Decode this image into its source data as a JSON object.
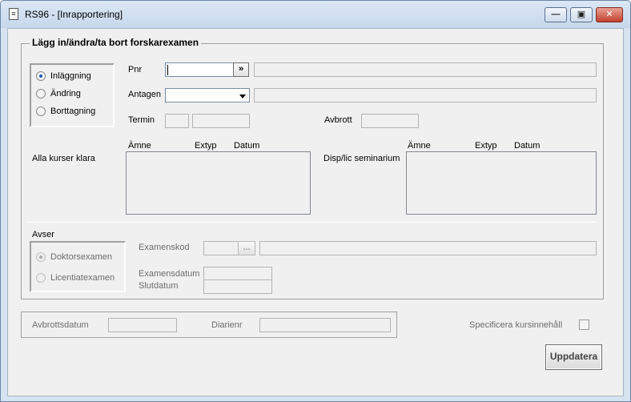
{
  "window": {
    "title": "RS96 - [Inrapportering]"
  },
  "group_main": {
    "legend": "Lägg in/ändra/ta bort forskarexamen",
    "mode_options": [
      {
        "label": "Inläggning",
        "selected": true
      },
      {
        "label": "Ändring",
        "selected": false
      },
      {
        "label": "Borttagning",
        "selected": false
      }
    ],
    "pnr_label": "Pnr",
    "pnr_value": "",
    "pnr_button": "»",
    "antagen_label": "Antagen",
    "antagen_value": "",
    "termin_label": "Termin",
    "avbrott_label": "Avbrott",
    "alla_kurser_label": "Alla kurser klara",
    "disp_label": "Disp/lic seminarium",
    "list_headers_left": [
      "Ämne",
      "Extyp",
      "Datum"
    ],
    "list_headers_right": [
      "Ämne",
      "Extyp",
      "Datum"
    ],
    "avser_label": "Avser",
    "avser_options": [
      {
        "label": "Doktorsexamen",
        "selected": true
      },
      {
        "label": "Licentiatexamen",
        "selected": false
      }
    ],
    "examenskod_label": "Examenskod",
    "examenskod_button": "...",
    "examensdatum_label": "Examensdatum",
    "slutdatum_label": "Slutdatum"
  },
  "group_bottom": {
    "avbrottsdatum_label": "Avbrottsdatum",
    "diarienr_label": "Diarienr"
  },
  "specificera_label": "Specificera kursinnehåll",
  "specificera_checked": false,
  "update_button": "Uppdatera",
  "icons": {
    "app": "document-icon",
    "minimize": "minimize-icon",
    "maximize": "maximize-icon",
    "close": "close-icon",
    "dropdown": "chevron-down-icon"
  }
}
